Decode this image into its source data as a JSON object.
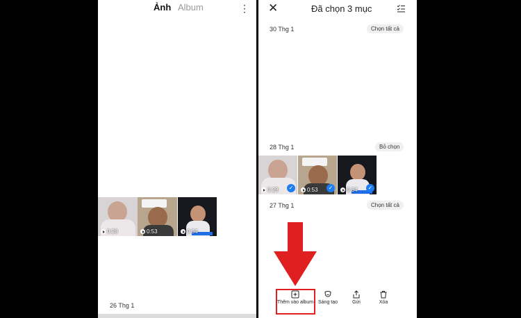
{
  "left": {
    "tabs": {
      "active": "Ảnh",
      "inactive": "Album"
    },
    "videos": [
      "0:28",
      "0:53",
      "0:34"
    ],
    "date_bottom": "26 Thg 1"
  },
  "right": {
    "header": {
      "title": "Đã chọn 3 mục"
    },
    "sections": [
      {
        "date": "30 Thg 1",
        "action": "Chọn tất cả"
      },
      {
        "date": "28 Thg 1",
        "action": "Bỏ chọn"
      },
      {
        "date": "27 Thg 1",
        "action": "Chọn tất cả"
      }
    ],
    "videos": [
      "0:28",
      "0:53",
      "0:34"
    ],
    "actions": [
      {
        "label": "Thêm vào album",
        "icon": "add-to-album-icon"
      },
      {
        "label": "Sáng tạo",
        "icon": "create-icon"
      },
      {
        "label": "Gửi",
        "icon": "share-icon"
      },
      {
        "label": "Xóa",
        "icon": "trash-icon"
      }
    ]
  },
  "colors": {
    "highlight": "#e02020",
    "arrow": "#e02020",
    "check": "#1e7cf2"
  }
}
